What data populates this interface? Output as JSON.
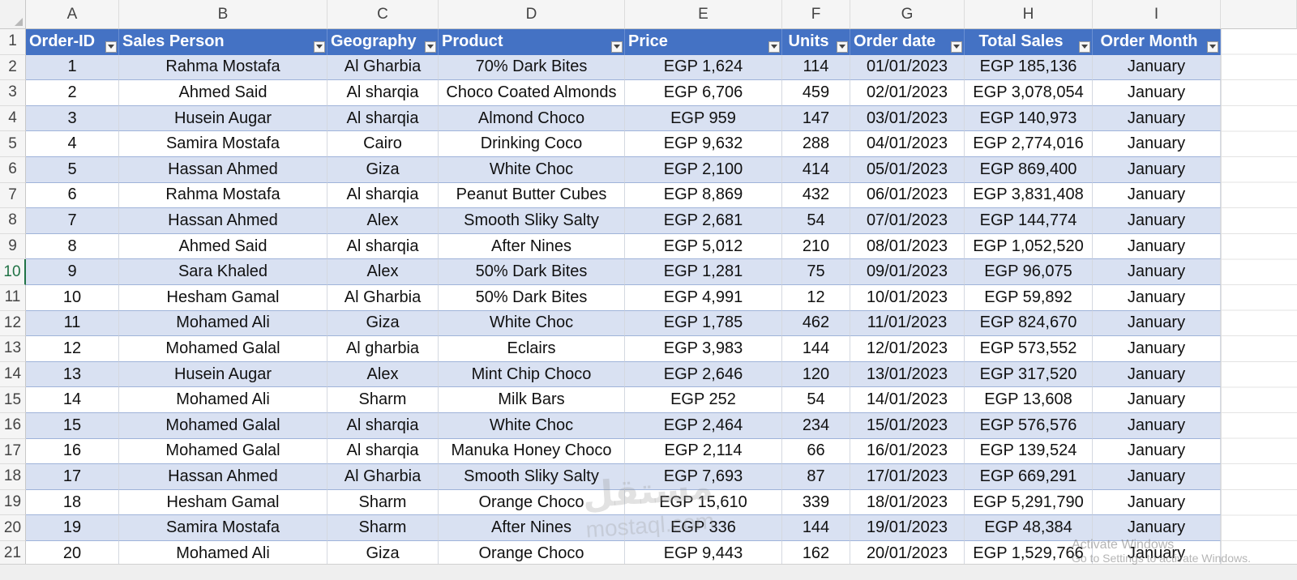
{
  "column_letters": [
    "A",
    "B",
    "C",
    "D",
    "E",
    "F",
    "G",
    "H",
    "I"
  ],
  "row_numbers": [
    "1",
    "2",
    "3",
    "4",
    "5",
    "6",
    "7",
    "8",
    "9",
    "10",
    "11",
    "12",
    "13",
    "14",
    "15",
    "16",
    "17",
    "18",
    "19",
    "20",
    "21"
  ],
  "active_row": "10",
  "headers": [
    "Order-ID",
    "Sales Person",
    "Geography",
    "Product",
    "Price",
    "Units",
    "Order date",
    "Total Sales",
    "Order Month"
  ],
  "rows": [
    [
      "1",
      "Rahma Mostafa",
      "Al Gharbia",
      "70% Dark Bites",
      "EGP 1,624",
      "114",
      "01/01/2023",
      "EGP 185,136",
      "January"
    ],
    [
      "2",
      "Ahmed Said",
      "Al sharqia",
      "Choco Coated Almonds",
      "EGP 6,706",
      "459",
      "02/01/2023",
      "EGP 3,078,054",
      "January"
    ],
    [
      "3",
      "Husein Augar",
      "Al sharqia",
      "Almond Choco",
      "EGP 959",
      "147",
      "03/01/2023",
      "EGP 140,973",
      "January"
    ],
    [
      "4",
      "Samira Mostafa",
      "Cairo",
      "Drinking Coco",
      "EGP 9,632",
      "288",
      "04/01/2023",
      "EGP 2,774,016",
      "January"
    ],
    [
      "5",
      "Hassan Ahmed",
      "Giza",
      "White Choc",
      "EGP 2,100",
      "414",
      "05/01/2023",
      "EGP 869,400",
      "January"
    ],
    [
      "6",
      "Rahma Mostafa",
      "Al sharqia",
      "Peanut Butter Cubes",
      "EGP 8,869",
      "432",
      "06/01/2023",
      "EGP 3,831,408",
      "January"
    ],
    [
      "7",
      "Hassan Ahmed",
      "Alex",
      "Smooth Sliky Salty",
      "EGP 2,681",
      "54",
      "07/01/2023",
      "EGP 144,774",
      "January"
    ],
    [
      "8",
      "Ahmed Said",
      "Al sharqia",
      "After Nines",
      "EGP 5,012",
      "210",
      "08/01/2023",
      "EGP 1,052,520",
      "January"
    ],
    [
      "9",
      "Sara Khaled",
      "Alex",
      "50% Dark Bites",
      "EGP 1,281",
      "75",
      "09/01/2023",
      "EGP 96,075",
      "January"
    ],
    [
      "10",
      "Hesham Gamal",
      "Al Gharbia",
      "50% Dark Bites",
      "EGP 4,991",
      "12",
      "10/01/2023",
      "EGP 59,892",
      "January"
    ],
    [
      "11",
      "Mohamed Ali",
      "Giza",
      "White Choc",
      "EGP 1,785",
      "462",
      "11/01/2023",
      "EGP 824,670",
      "January"
    ],
    [
      "12",
      "Mohamed Galal",
      "Al gharbia",
      "Eclairs",
      "EGP 3,983",
      "144",
      "12/01/2023",
      "EGP 573,552",
      "January"
    ],
    [
      "13",
      "Husein Augar",
      "Alex",
      "Mint Chip Choco",
      "EGP 2,646",
      "120",
      "13/01/2023",
      "EGP 317,520",
      "January"
    ],
    [
      "14",
      "Mohamed Ali",
      "Sharm",
      "Milk Bars",
      "EGP 252",
      "54",
      "14/01/2023",
      "EGP 13,608",
      "January"
    ],
    [
      "15",
      "Mohamed Galal",
      "Al sharqia",
      "White Choc",
      "EGP 2,464",
      "234",
      "15/01/2023",
      "EGP 576,576",
      "January"
    ],
    [
      "16",
      "Mohamed Galal",
      "Al sharqia",
      "Manuka Honey Choco",
      "EGP 2,114",
      "66",
      "16/01/2023",
      "EGP 139,524",
      "January"
    ],
    [
      "17",
      "Hassan Ahmed",
      "Al Gharbia",
      "Smooth Sliky Salty",
      "EGP 7,693",
      "87",
      "17/01/2023",
      "EGP 669,291",
      "January"
    ],
    [
      "18",
      "Hesham Gamal",
      "Sharm",
      "Orange Choco",
      "EGP 15,610",
      "339",
      "18/01/2023",
      "EGP 5,291,790",
      "January"
    ],
    [
      "19",
      "Samira Mostafa",
      "Sharm",
      "After Nines",
      "EGP 336",
      "144",
      "19/01/2023",
      "EGP 48,384",
      "January"
    ],
    [
      "20",
      "Mohamed Ali",
      "Giza",
      "Orange Choco",
      "EGP 9,443",
      "162",
      "20/01/2023",
      "EGP 1,529,766",
      "January"
    ]
  ],
  "watermark": {
    "arabic": "مستقل",
    "latin": "mostaql.com"
  },
  "activation_notice": {
    "line1": "Activate Windows",
    "line2": "Go to Settings to activate Windows."
  }
}
